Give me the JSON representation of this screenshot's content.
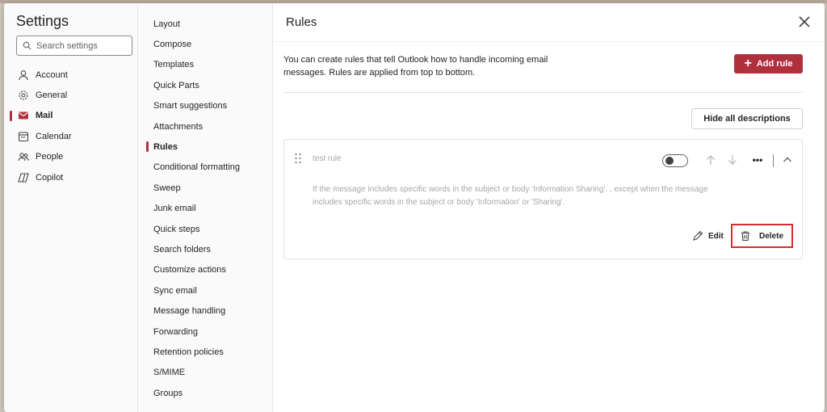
{
  "settings_panel": {
    "title": "Settings",
    "search": {
      "placeholder": "Search settings",
      "value": ""
    },
    "items": [
      {
        "label": "Account",
        "icon": "person-icon"
      },
      {
        "label": "General",
        "icon": "gear-icon"
      },
      {
        "label": "Mail",
        "icon": "mail-icon",
        "active": true
      },
      {
        "label": "Calendar",
        "icon": "calendar-icon"
      },
      {
        "label": "People",
        "icon": "people-icon"
      },
      {
        "label": "Copilot",
        "icon": "copilot-icon"
      }
    ]
  },
  "mail_nav": {
    "items": [
      "Layout",
      "Compose",
      "Templates",
      "Quick Parts",
      "Smart suggestions",
      "Attachments",
      "Rules",
      "Conditional formatting",
      "Sweep",
      "Junk email",
      "Quick steps",
      "Search folders",
      "Customize actions",
      "Sync email",
      "Message handling",
      "Forwarding",
      "Retention policies",
      "S/MIME",
      "Groups"
    ],
    "active": "Rules"
  },
  "main": {
    "title": "Rules",
    "description": "You can create rules that tell Outlook how to handle incoming email messages. Rules are applied from top to bottom.",
    "add_rule_label": "Add rule",
    "hide_descriptions_label": "Hide all descriptions",
    "rule": {
      "name": "test rule",
      "enabled": false,
      "description": "If the message includes specific words in the subject or body 'Information Sharing'. , except when the message includes specific words in the subject or body 'Information' or 'Sharing'.",
      "edit_label": "Edit",
      "delete_label": "Delete",
      "more_label": "•••"
    }
  },
  "colors": {
    "accent": "#b1303e",
    "highlight_border": "#d32f2f"
  }
}
